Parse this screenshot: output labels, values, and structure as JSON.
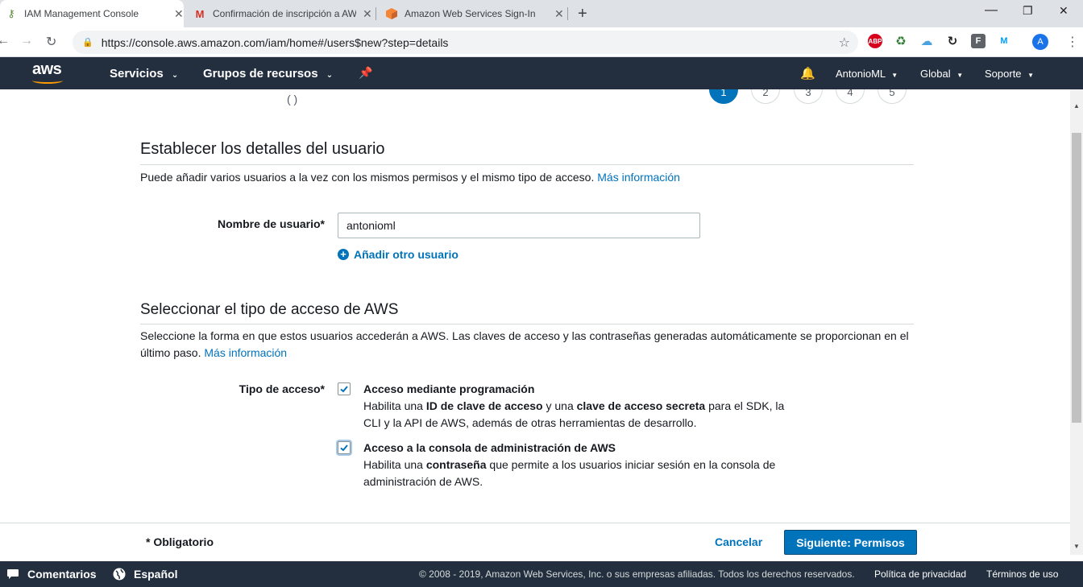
{
  "browser": {
    "tabs": [
      {
        "title": "IAM Management Console",
        "favicon": "aws-key-icon",
        "close": "✕"
      },
      {
        "title": "Confirmación de inscripción a AWS",
        "favicon": "gmail-icon",
        "close": "✕"
      },
      {
        "title": "Amazon Web Services Sign-In",
        "favicon": "aws-cube-icon",
        "close": "✕"
      }
    ],
    "new_tab": "+",
    "url": "https://console.aws.amazon.com/iam/home#/users$new?step=details",
    "profile_initial": "A",
    "extensions": [
      {
        "name": "adblock-icon",
        "label": "ABP",
        "color": "#d6001c"
      },
      {
        "name": "recycle-icon",
        "label": "♻",
        "color": "#2e7d32"
      },
      {
        "name": "cloud-icon",
        "label": "☁",
        "color": "#4aa3df"
      },
      {
        "name": "sync-icon",
        "label": "↻",
        "color": "#202124"
      },
      {
        "name": "f-icon",
        "label": "F",
        "color": "#5f6368"
      },
      {
        "name": "movistar-icon",
        "label": "M",
        "color": "#019df4"
      }
    ]
  },
  "aws_nav": {
    "logo": "aws",
    "services": "Servicios",
    "resource_groups": "Grupos de recursos",
    "account": "AntonioML",
    "region": "Global",
    "support": "Soporte"
  },
  "wizard": {
    "steps": [
      "1",
      "2",
      "3",
      "4",
      "5"
    ],
    "active_step": 1
  },
  "details": {
    "title": "Establecer los detalles del usuario",
    "description": "Puede añadir varios usuarios a la vez con los mismos permisos y el mismo tipo de acceso.",
    "more_info": "Más información",
    "username_label": "Nombre de usuario*",
    "username_value": "antonioml",
    "add_user": "Añadir otro usuario"
  },
  "access": {
    "title": "Seleccionar el tipo de acceso de AWS",
    "description": "Seleccione la forma en que estos usuarios accederán a AWS. Las claves de acceso y las contraseñas generadas automáticamente se proporcionan en el último paso.",
    "more_info": "Más información",
    "type_label": "Tipo de acceso*",
    "options": [
      {
        "title": "Acceso mediante programación",
        "checked": true,
        "desc_pre": "Habilita una ",
        "desc_b1": "ID de clave de acceso",
        "desc_mid": " y una ",
        "desc_b2": "clave de acceso secreta",
        "desc_post": " para el SDK, la CLI y la API de AWS, además de otras herramientas de desarrollo."
      },
      {
        "title": "Acceso a la consola de administración de AWS",
        "checked": true,
        "desc_pre": "Habilita una ",
        "desc_b1": "contraseña",
        "desc_post": " que permite a los usuarios iniciar sesión en la consola de administración de AWS."
      }
    ]
  },
  "actions": {
    "required": "* Obligatorio",
    "cancel": "Cancelar",
    "next": "Siguiente: Permisos"
  },
  "footer": {
    "feedback": "Comentarios",
    "language": "Español",
    "copyright": "© 2008 - 2019, Amazon Web Services, Inc. o sus empresas afiliadas. Todos los derechos reservados.",
    "privacy": "Política de privacidad",
    "terms": "Términos de uso"
  },
  "colors": {
    "aws_nav": "#232f3e",
    "link": "#0073bb",
    "aws_orange": "#ff9900"
  }
}
